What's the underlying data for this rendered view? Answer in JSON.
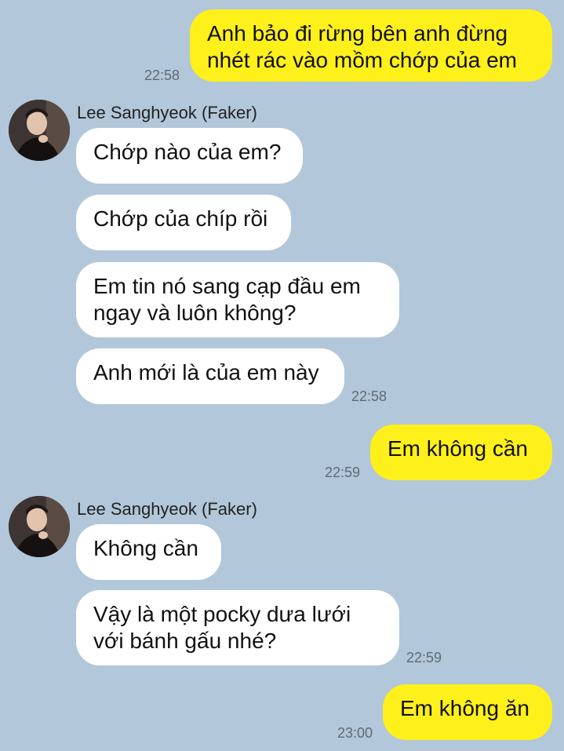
{
  "contact": {
    "name": "Lee Sanghyeok (Faker)"
  },
  "messages": {
    "m1": {
      "text": "Anh bảo đi rừng bên anh đừng\nnhét rác vào mồm chớp của em",
      "time": "22:58"
    },
    "m2": {
      "text": "Chớp nào của em?"
    },
    "m3": {
      "text": "Chớp của chíp rồi"
    },
    "m4": {
      "text": "Em tin nó sang cạp đầu em\nngay và luôn không?"
    },
    "m5": {
      "text": "Anh mới là của em này",
      "time": "22:58"
    },
    "m6": {
      "text": "Em không cần",
      "time": "22:59"
    },
    "m7": {
      "text": "Không cần"
    },
    "m8": {
      "text": "Vậy là một pocky dưa lưới\nvới bánh gấu nhé?",
      "time": "22:59"
    },
    "m9": {
      "text": "Em không ăn",
      "time": "23:00"
    }
  },
  "colors": {
    "background": "#b2c7d9",
    "outgoing_bubble": "#fef01b",
    "incoming_bubble": "#ffffff"
  }
}
